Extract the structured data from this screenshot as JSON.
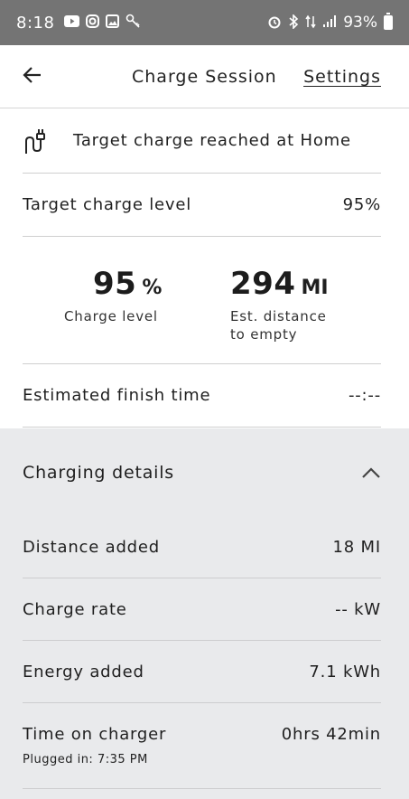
{
  "status_bar": {
    "time": "8:18",
    "battery": "93%",
    "left_icons": [
      "youtube-icon",
      "instagram-icon",
      "gallery-icon",
      "key-icon"
    ],
    "right_icons": [
      "alarm-icon",
      "bluetooth-icon",
      "data-icon",
      "signal-icon"
    ]
  },
  "header": {
    "title": "Charge Session",
    "settings_label": "Settings"
  },
  "status": {
    "message": "Target charge reached at Home"
  },
  "target": {
    "label": "Target charge level",
    "value": "95%"
  },
  "stats": {
    "charge_value": "95",
    "charge_unit": "%",
    "charge_label": "Charge level",
    "distance_value": "294",
    "distance_unit": "MI",
    "distance_label_1": "Est. distance",
    "distance_label_2": "to empty"
  },
  "finish": {
    "label": "Estimated finish time",
    "value": "--:--"
  },
  "details": {
    "title": "Charging details",
    "rows": [
      {
        "label": "Distance added",
        "value": "18 MI"
      },
      {
        "label": "Charge rate",
        "value": "-- kW"
      },
      {
        "label": "Energy added",
        "value": "7.1 kWh"
      },
      {
        "label": "Time on charger",
        "value": "0hrs 42min",
        "sublabel": "Plugged in: 7:35 PM"
      }
    ]
  }
}
